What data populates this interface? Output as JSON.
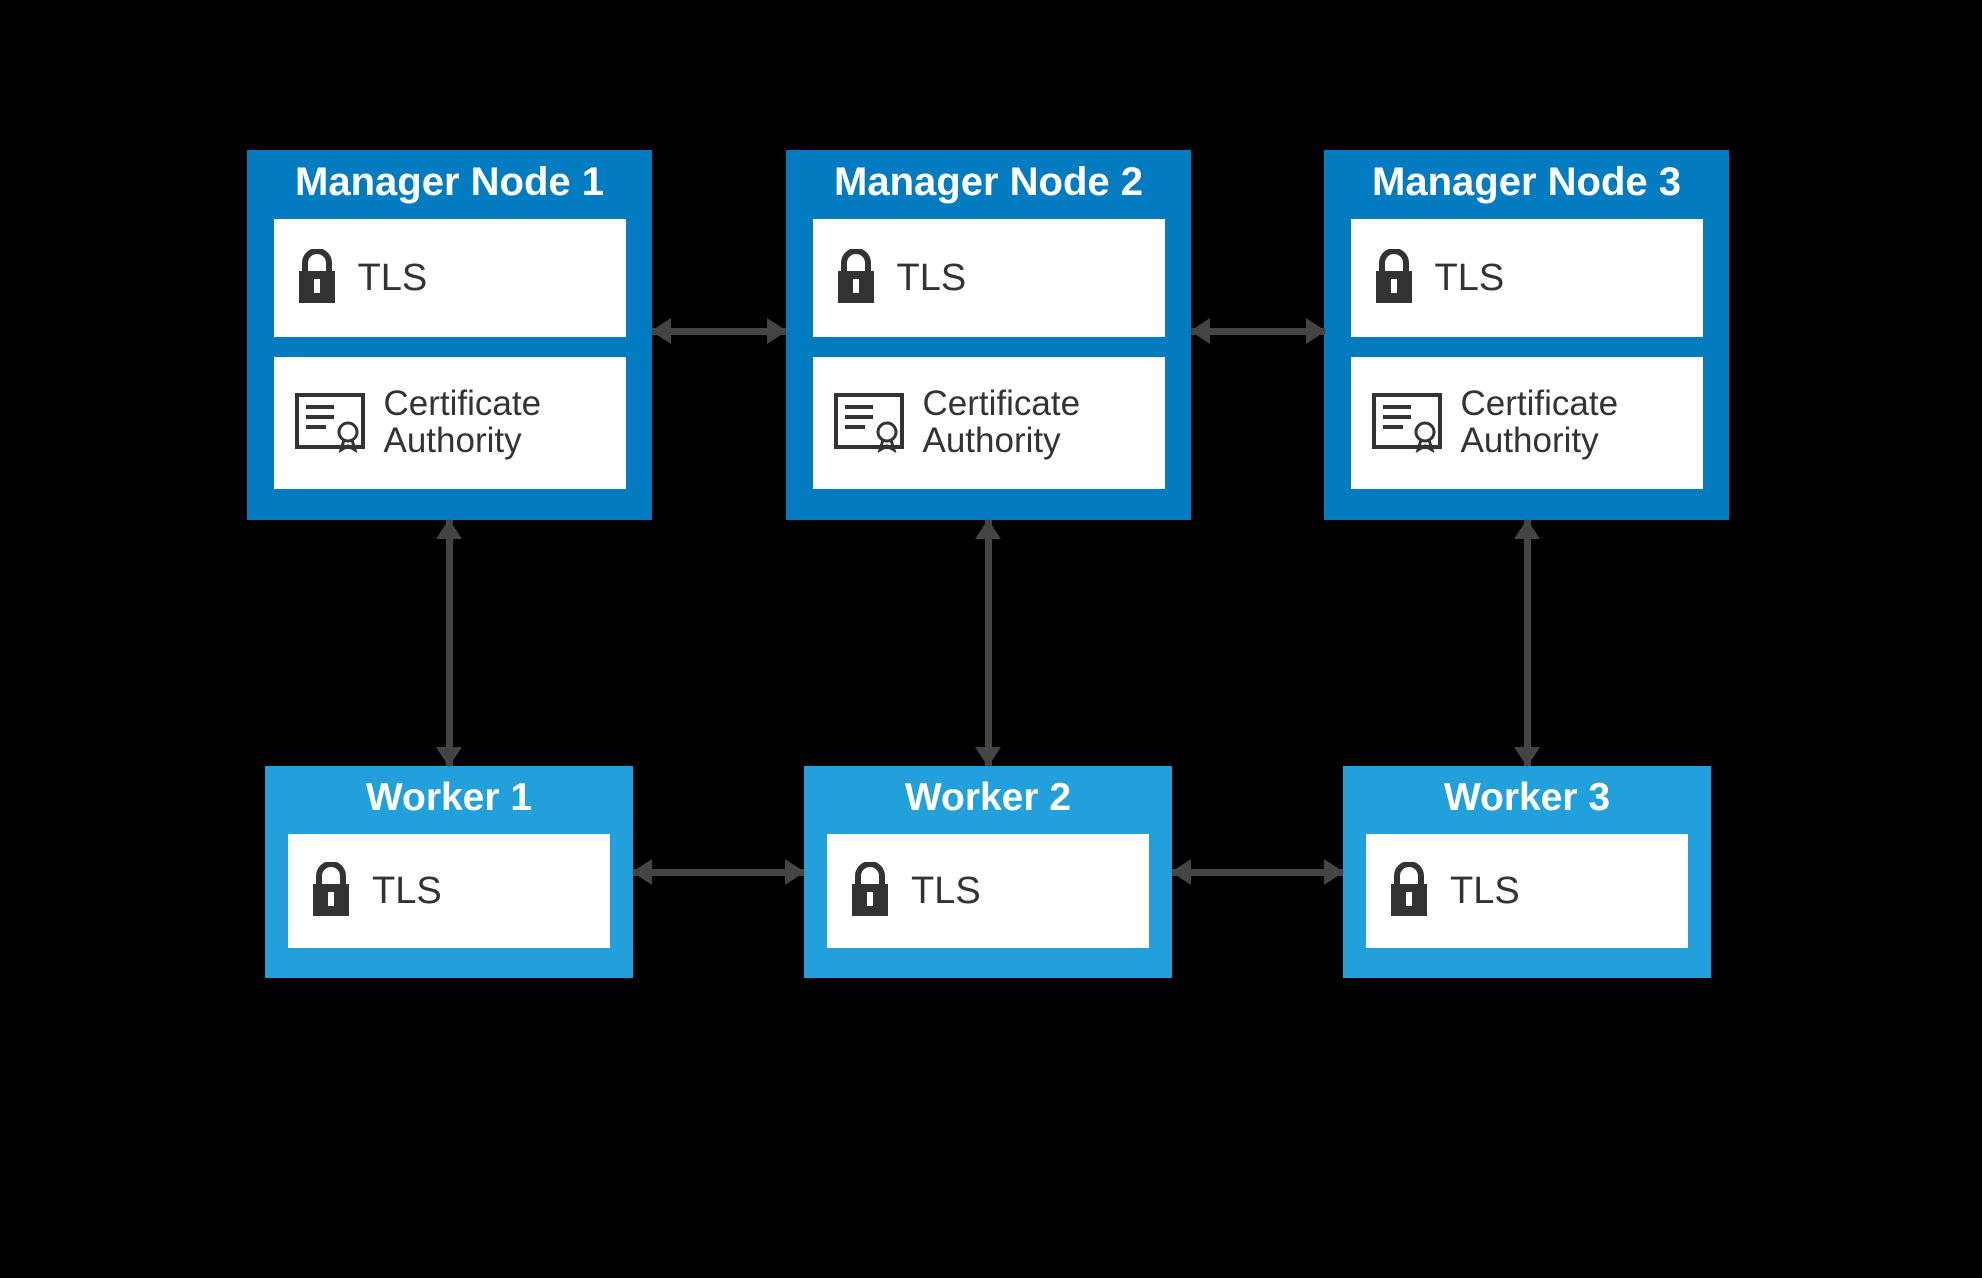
{
  "managers": [
    {
      "title": "Manager Node 1",
      "tls": "TLS",
      "ca": "Certificate Authority"
    },
    {
      "title": "Manager Node 2",
      "tls": "TLS",
      "ca": "Certificate Authority"
    },
    {
      "title": "Manager Node 3",
      "tls": "TLS",
      "ca": "Certificate Authority"
    }
  ],
  "workers": [
    {
      "title": "Worker 1",
      "tls": "TLS"
    },
    {
      "title": "Worker 2",
      "tls": "TLS"
    },
    {
      "title": "Worker 3",
      "tls": "TLS"
    }
  ],
  "colors": {
    "manager_bg": "#037bc1",
    "worker_bg": "#22a0dc",
    "arrow": "#444444",
    "card_bg": "#ffffff"
  },
  "icons": {
    "lock": "lock-icon",
    "certificate": "certificate-icon"
  }
}
